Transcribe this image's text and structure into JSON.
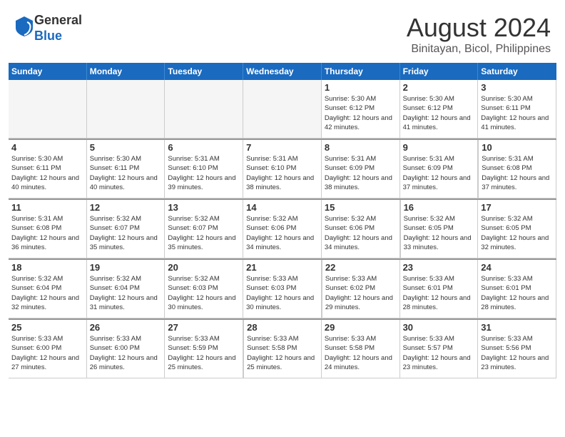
{
  "header": {
    "logo": {
      "line1": "General",
      "line2": "Blue"
    },
    "title": "August 2024",
    "subtitle": "Binitayan, Bicol, Philippines"
  },
  "calendar": {
    "days_of_week": [
      "Sunday",
      "Monday",
      "Tuesday",
      "Wednesday",
      "Thursday",
      "Friday",
      "Saturday"
    ],
    "weeks": [
      [
        {
          "day": "",
          "empty": true
        },
        {
          "day": "",
          "empty": true
        },
        {
          "day": "",
          "empty": true
        },
        {
          "day": "",
          "empty": true
        },
        {
          "day": "1",
          "sunrise": "5:30 AM",
          "sunset": "6:12 PM",
          "daylight": "12 hours and 42 minutes."
        },
        {
          "day": "2",
          "sunrise": "5:30 AM",
          "sunset": "6:12 PM",
          "daylight": "12 hours and 41 minutes."
        },
        {
          "day": "3",
          "sunrise": "5:30 AM",
          "sunset": "6:11 PM",
          "daylight": "12 hours and 41 minutes."
        }
      ],
      [
        {
          "day": "4",
          "sunrise": "5:30 AM",
          "sunset": "6:11 PM",
          "daylight": "12 hours and 40 minutes."
        },
        {
          "day": "5",
          "sunrise": "5:30 AM",
          "sunset": "6:11 PM",
          "daylight": "12 hours and 40 minutes."
        },
        {
          "day": "6",
          "sunrise": "5:31 AM",
          "sunset": "6:10 PM",
          "daylight": "12 hours and 39 minutes."
        },
        {
          "day": "7",
          "sunrise": "5:31 AM",
          "sunset": "6:10 PM",
          "daylight": "12 hours and 38 minutes."
        },
        {
          "day": "8",
          "sunrise": "5:31 AM",
          "sunset": "6:09 PM",
          "daylight": "12 hours and 38 minutes."
        },
        {
          "day": "9",
          "sunrise": "5:31 AM",
          "sunset": "6:09 PM",
          "daylight": "12 hours and 37 minutes."
        },
        {
          "day": "10",
          "sunrise": "5:31 AM",
          "sunset": "6:08 PM",
          "daylight": "12 hours and 37 minutes."
        }
      ],
      [
        {
          "day": "11",
          "sunrise": "5:31 AM",
          "sunset": "6:08 PM",
          "daylight": "12 hours and 36 minutes."
        },
        {
          "day": "12",
          "sunrise": "5:32 AM",
          "sunset": "6:07 PM",
          "daylight": "12 hours and 35 minutes."
        },
        {
          "day": "13",
          "sunrise": "5:32 AM",
          "sunset": "6:07 PM",
          "daylight": "12 hours and 35 minutes."
        },
        {
          "day": "14",
          "sunrise": "5:32 AM",
          "sunset": "6:06 PM",
          "daylight": "12 hours and 34 minutes."
        },
        {
          "day": "15",
          "sunrise": "5:32 AM",
          "sunset": "6:06 PM",
          "daylight": "12 hours and 34 minutes."
        },
        {
          "day": "16",
          "sunrise": "5:32 AM",
          "sunset": "6:05 PM",
          "daylight": "12 hours and 33 minutes."
        },
        {
          "day": "17",
          "sunrise": "5:32 AM",
          "sunset": "6:05 PM",
          "daylight": "12 hours and 32 minutes."
        }
      ],
      [
        {
          "day": "18",
          "sunrise": "5:32 AM",
          "sunset": "6:04 PM",
          "daylight": "12 hours and 32 minutes."
        },
        {
          "day": "19",
          "sunrise": "5:32 AM",
          "sunset": "6:04 PM",
          "daylight": "12 hours and 31 minutes."
        },
        {
          "day": "20",
          "sunrise": "5:32 AM",
          "sunset": "6:03 PM",
          "daylight": "12 hours and 30 minutes."
        },
        {
          "day": "21",
          "sunrise": "5:33 AM",
          "sunset": "6:03 PM",
          "daylight": "12 hours and 30 minutes."
        },
        {
          "day": "22",
          "sunrise": "5:33 AM",
          "sunset": "6:02 PM",
          "daylight": "12 hours and 29 minutes."
        },
        {
          "day": "23",
          "sunrise": "5:33 AM",
          "sunset": "6:01 PM",
          "daylight": "12 hours and 28 minutes."
        },
        {
          "day": "24",
          "sunrise": "5:33 AM",
          "sunset": "6:01 PM",
          "daylight": "12 hours and 28 minutes."
        }
      ],
      [
        {
          "day": "25",
          "sunrise": "5:33 AM",
          "sunset": "6:00 PM",
          "daylight": "12 hours and 27 minutes."
        },
        {
          "day": "26",
          "sunrise": "5:33 AM",
          "sunset": "6:00 PM",
          "daylight": "12 hours and 26 minutes."
        },
        {
          "day": "27",
          "sunrise": "5:33 AM",
          "sunset": "5:59 PM",
          "daylight": "12 hours and 25 minutes."
        },
        {
          "day": "28",
          "sunrise": "5:33 AM",
          "sunset": "5:58 PM",
          "daylight": "12 hours and 25 minutes."
        },
        {
          "day": "29",
          "sunrise": "5:33 AM",
          "sunset": "5:58 PM",
          "daylight": "12 hours and 24 minutes."
        },
        {
          "day": "30",
          "sunrise": "5:33 AM",
          "sunset": "5:57 PM",
          "daylight": "12 hours and 23 minutes."
        },
        {
          "day": "31",
          "sunrise": "5:33 AM",
          "sunset": "5:56 PM",
          "daylight": "12 hours and 23 minutes."
        }
      ]
    ]
  }
}
